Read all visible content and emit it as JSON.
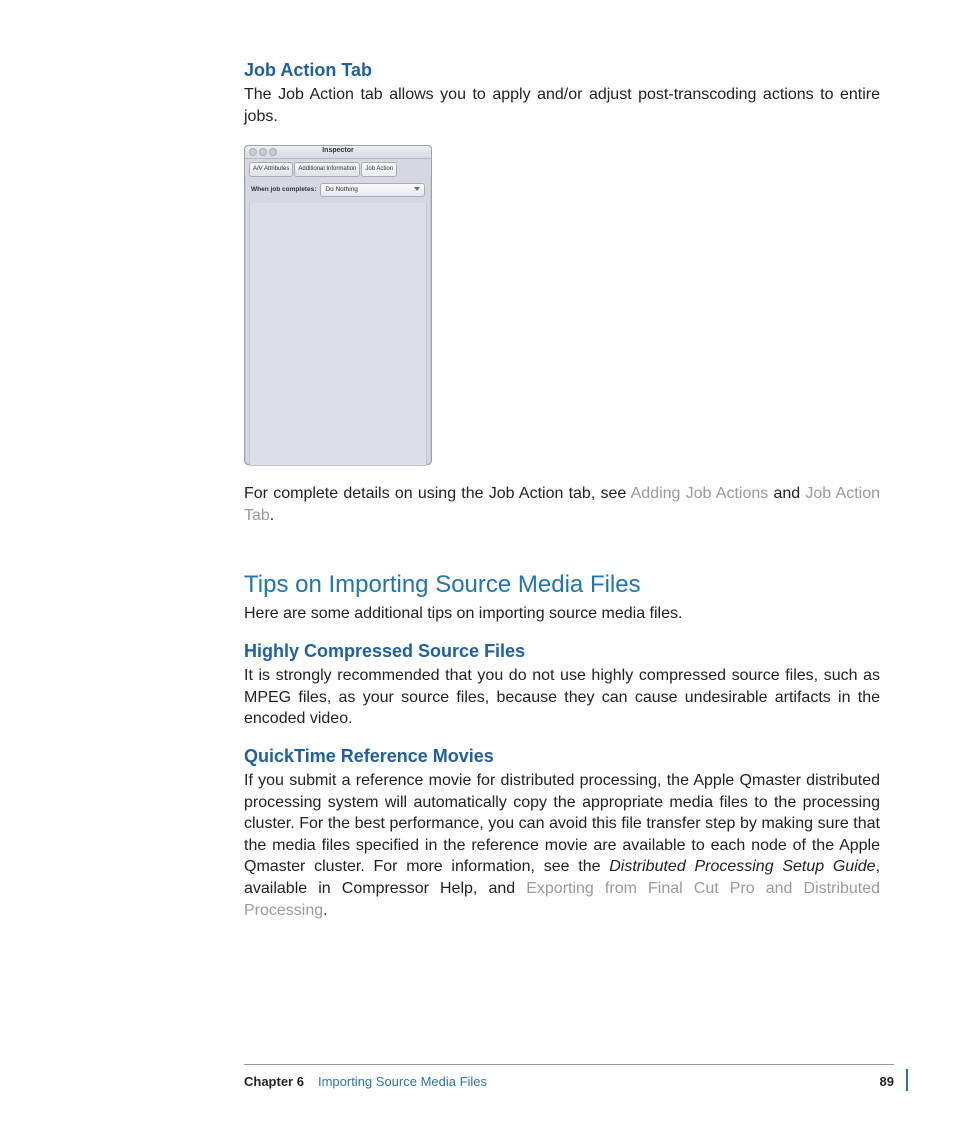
{
  "sec1": {
    "title": "Job Action Tab",
    "p1": "The Job Action tab allows you to apply and/or adjust post-transcoding actions to entire jobs.",
    "p2a": "For complete details on using the Job Action tab, see ",
    "link1": "Adding Job Actions",
    "p2b": " and ",
    "link2": "Job Action Tab",
    "p2c": "."
  },
  "inspector": {
    "title": "Inspector",
    "tabs": [
      "A/V Attributes",
      "Additional Information",
      "Job Action"
    ],
    "row_label": "When job completes:",
    "row_value": "Do Nothing"
  },
  "sec2": {
    "title": "Tips on Importing Source Media Files",
    "intro": "Here are some additional tips on importing source media files."
  },
  "sec3": {
    "title": "Highly Compressed Source Files",
    "p": "It is strongly recommended that you do not use highly compressed source files, such as MPEG files, as your source files, because they can cause undesirable artifacts in the encoded video."
  },
  "sec4": {
    "title": "QuickTime Reference Movies",
    "p_a": "If you submit a reference movie for distributed processing, the Apple Qmaster distributed processing system will automatically copy the appropriate media files to the processing cluster. For the best performance, you can avoid this file transfer step by making sure that the media files specified in the reference movie are available to each node of the Apple Qmaster cluster. For more information, see the ",
    "p_ital": "Distributed Processing Setup Guide",
    "p_b": ", available in Compressor Help, and ",
    "p_link": "Exporting from Final Cut Pro and Distributed Processing",
    "p_c": "."
  },
  "footer": {
    "chapter": "Chapter 6",
    "name": "Importing Source Media Files",
    "page": "89"
  }
}
